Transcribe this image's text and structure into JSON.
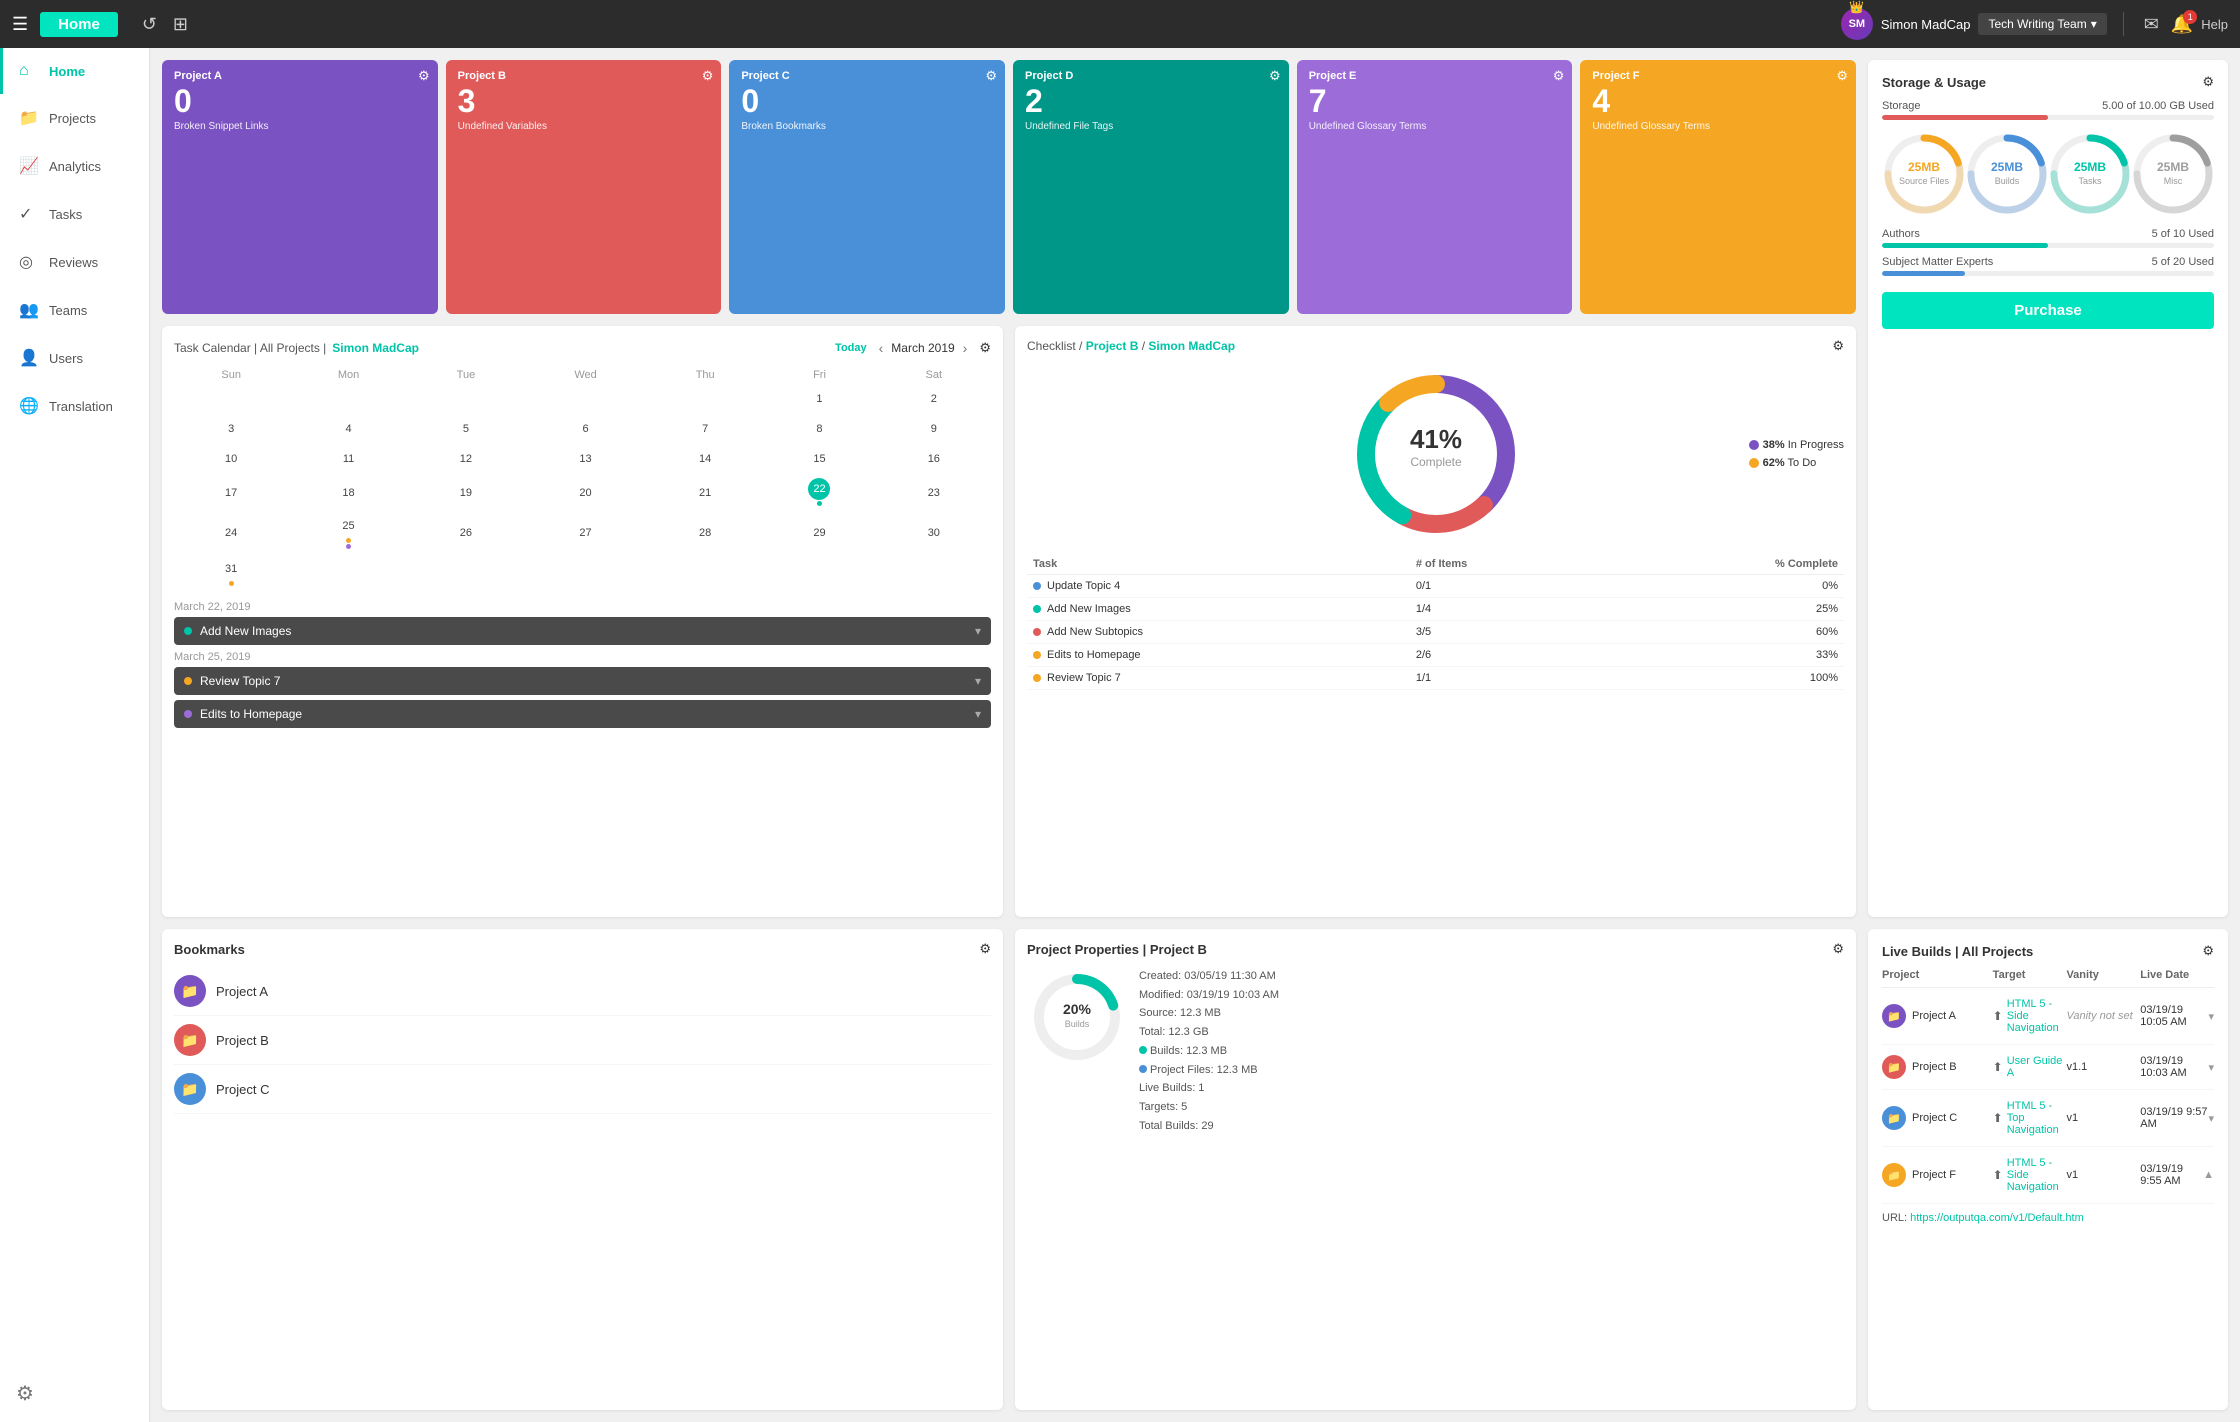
{
  "topNav": {
    "hamburger": "☰",
    "homeLabel": "Home",
    "refreshTitle": "Refresh",
    "newTabTitle": "New Tab",
    "userName": "Simon MadCap",
    "userInitials": "SM",
    "teamName": "Tech Writing Team",
    "helpLabel": "Help",
    "notifCount": "1"
  },
  "sidebar": {
    "items": [
      {
        "id": "home",
        "label": "Home",
        "icon": "⌂",
        "active": true
      },
      {
        "id": "projects",
        "label": "Projects",
        "icon": "📁"
      },
      {
        "id": "analytics",
        "label": "Analytics",
        "icon": "📈"
      },
      {
        "id": "tasks",
        "label": "Tasks",
        "icon": "✓"
      },
      {
        "id": "reviews",
        "label": "Reviews",
        "icon": "◎"
      },
      {
        "id": "teams",
        "label": "Teams",
        "icon": "👤"
      },
      {
        "id": "users",
        "label": "Users",
        "icon": "👤"
      },
      {
        "id": "translation",
        "label": "Translation",
        "icon": "A"
      }
    ]
  },
  "projectCards": [
    {
      "label": "Project A",
      "num": "0",
      "desc": "Broken Snippet Links",
      "color": "#7b52c1"
    },
    {
      "label": "Project B",
      "num": "3",
      "desc": "Undefined Variables",
      "color": "#e05a5a"
    },
    {
      "label": "Project C",
      "num": "0",
      "desc": "Broken Bookmarks",
      "color": "#4a90d9"
    },
    {
      "label": "Project D",
      "num": "2",
      "desc": "Undefined File Tags",
      "color": "#009688"
    },
    {
      "label": "Project E",
      "num": "7",
      "desc": "Undefined Glossary Terms",
      "color": "#9c6dd8"
    },
    {
      "label": "Project F",
      "num": "4",
      "desc": "Undefined Glossary Terms",
      "color": "#f5a623"
    }
  ],
  "storage": {
    "title": "Storage & Usage",
    "storageLabel": "Storage",
    "storageUsed": "5.00 of 10.00 GB Used",
    "storagePct": 50,
    "storageColor": "#e05a5a",
    "donuts": [
      {
        "label": "Source Files",
        "value": "25MB",
        "color": "#f5a623",
        "pct": 25
      },
      {
        "label": "Builds",
        "value": "25MB",
        "color": "#4a90d9",
        "pct": 25
      },
      {
        "label": "Tasks",
        "value": "25MB",
        "color": "#00c4a7",
        "pct": 25
      },
      {
        "label": "Misc",
        "value": "25MB",
        "color": "#9e9e9e",
        "pct": 25
      }
    ],
    "authorsLabel": "Authors",
    "authorsUsed": "5 of 10 Used",
    "authorsPct": 50,
    "authorsColor": "#00c4a7",
    "smeLabel": "Subject Matter Experts",
    "smeUsed": "5 of 20 Used",
    "smePct": 25,
    "smeColor": "#4a90d9",
    "purchaseLabel": "Purchase"
  },
  "calendar": {
    "title": "Task Calendar | All Projects",
    "userLink": "Simon MadCap",
    "todayLabel": "Today",
    "month": "March 2019",
    "dayHeaders": [
      "Sun",
      "Mon",
      "Tue",
      "Wed",
      "Thu",
      "Fri",
      "Sat"
    ],
    "weeks": [
      [
        null,
        null,
        null,
        null,
        null,
        "1",
        "2"
      ],
      [
        "3",
        "4",
        "5",
        "6",
        "7",
        "8",
        "9"
      ],
      [
        "10",
        "11",
        "12",
        "13",
        "14",
        "15",
        "16"
      ],
      [
        "17",
        "18",
        "19",
        "20",
        "21",
        "22",
        "23"
      ],
      [
        "24",
        "25",
        "26",
        "27",
        "28",
        "29",
        "30"
      ],
      [
        "31",
        null,
        null,
        null,
        null,
        null,
        null
      ]
    ],
    "todayDate": "22",
    "dots": {
      "25": [
        "#f5a623",
        "#9c6dd8"
      ],
      "31": [
        "#f5a623"
      ]
    },
    "todayIndicator": {
      "row": 3,
      "col": 6
    }
  },
  "tasks": [
    {
      "date": "March 22, 2019",
      "label": "Add New Images",
      "dotColor": "#00c4a7",
      "expanded": false
    },
    {
      "date": "March 25, 2019",
      "label": "Review Topic 7",
      "dotColor": "#f5a623",
      "expanded": false
    },
    {
      "date": null,
      "label": "Edits to Homepage",
      "dotColor": "#9c6dd8",
      "expanded": false
    }
  ],
  "checklist": {
    "title": "Checklist",
    "project": "Project B",
    "user": "Simon MadCap",
    "pct": "41%",
    "completeLabel": "Complete",
    "inProgressPct": "38%",
    "inProgressLabel": "In Progress",
    "inProgressColor": "#7b52c1",
    "toDoPct": "62%",
    "toDoLabel": "To Do",
    "toDoColor": "#f5a623",
    "segments": [
      {
        "color": "#7b52c1",
        "pct": 38
      },
      {
        "color": "#e05a5a",
        "pct": 20
      },
      {
        "color": "#00c4a7",
        "pct": 30
      },
      {
        "color": "#f5a623",
        "pct": 12
      }
    ],
    "colHeaders": [
      "Task",
      "# of Items",
      "% Complete"
    ],
    "items": [
      {
        "name": "Update Topic 4",
        "color": "#4a90d9",
        "items": "0/1",
        "pct": "0%"
      },
      {
        "name": "Add New Images",
        "color": "#00c4a7",
        "items": "1/4",
        "pct": "25%"
      },
      {
        "name": "Add New Subtopics",
        "color": "#e05a5a",
        "items": "3/5",
        "pct": "60%"
      },
      {
        "name": "Edits to Homepage",
        "color": "#f5a623",
        "items": "2/6",
        "pct": "33%"
      },
      {
        "name": "Review Topic 7",
        "color": "#f5a623",
        "items": "1/1",
        "pct": "100%"
      }
    ]
  },
  "bookmarks": {
    "title": "Bookmarks",
    "items": [
      {
        "name": "Project A",
        "color": "#7b52c1"
      },
      {
        "name": "Project B",
        "color": "#e05a5a"
      },
      {
        "name": "Project C",
        "color": "#4a90d9"
      }
    ]
  },
  "projectProps": {
    "title": "Project Properties | Project B",
    "created": "03/05/19 11:30 AM",
    "modified": "03/19/19 10:03 AM",
    "source": "12.3 MB",
    "total": "12.3 GB",
    "builds": "12.3 MB",
    "projectFiles": "12.3 MB",
    "liveBuilds": "1",
    "targets": "5",
    "totalBuilds": "29",
    "donutPct": 20,
    "donutColor": "#00c4a7",
    "donutLabel": "Builds"
  },
  "liveBuilds": {
    "title": "Live Builds | All Projects",
    "colHeaders": [
      "Project",
      "Target",
      "Vanity",
      "Live Date"
    ],
    "rows": [
      {
        "project": "Project A",
        "projectColor": "#7b52c1",
        "target": "HTML 5 - Side Navigation",
        "vanity": "Vanity not set",
        "vanityItalic": true,
        "date": "03/19/19 10:05 AM",
        "expanded": false
      },
      {
        "project": "Project B",
        "projectColor": "#e05a5a",
        "target": "User Guide A",
        "vanity": "v1.1",
        "date": "03/19/19 10:03 AM",
        "expanded": false
      },
      {
        "project": "Project C",
        "projectColor": "#4a90d9",
        "target": "HTML 5 - Top Navigation",
        "vanity": "v1",
        "date": "03/19/19 9:57 AM",
        "expanded": false
      },
      {
        "project": "Project F",
        "projectColor": "#f5a623",
        "target": "HTML 5 - Side Navigation",
        "vanity": "v1",
        "date": "03/19/19 9:55 AM",
        "expanded": true
      }
    ],
    "expandedUrl": "https://outputqa.com/v1/Default.htm"
  }
}
